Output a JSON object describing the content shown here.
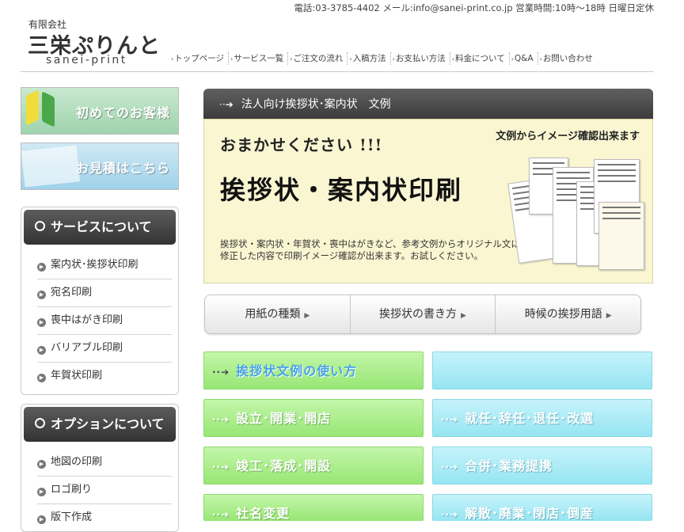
{
  "header": {
    "contact": "電話:03-3785-4402 メール:info@sanei-print.co.jp 営業時間:10時～18時 日曜日定休",
    "logo_company_type": "有限会社",
    "logo_name": "三栄ぷりんと",
    "logo_romaji": "sanei-print",
    "nav": [
      "トップページ",
      "サービス一覧",
      "ご注文の流れ",
      "入稿方法",
      "お支払い方法",
      "料金について",
      "Q&A",
      "お問い合わせ"
    ]
  },
  "sidebar": {
    "banner_first": "初めてのお客様",
    "banner_estimate": "お見積はこちら",
    "service_title": "サービスについて",
    "service_items": [
      "案内状･挨拶状印刷",
      "宛名印刷",
      "喪中はがき印刷",
      "バリアブル印刷",
      "年賀状印刷"
    ],
    "option_title": "オプションについて",
    "option_items": [
      "地図の印刷",
      "ロゴ刷り",
      "版下作成"
    ]
  },
  "main": {
    "title": "法人向け挨拶状･案内状　文例",
    "hero": {
      "tagline": "おまかせください !!!",
      "check_note": "文例からイメージ確認出来ます",
      "title": "挨拶状・案内状印刷",
      "description": "挨拶状・案内状・年賀状・喪中はがきなど、参考文例からオリジナル文に修正した内容で印刷イメージ確認が出来ます。お試しください。"
    },
    "tabs": [
      "用紙の種類",
      "挨拶状の書き方",
      "時候の挨拶用語"
    ],
    "categories": {
      "usage": "挨拶状文例の使い方",
      "c1": "設立･開業･開店",
      "c2": "就任･辞任･退任･改選",
      "c3": "竣工･落成･開設",
      "c4": "合併･業務提携",
      "c5": "社名変更",
      "c6": "解散･廃業･閉店･倒産"
    }
  },
  "colors": {
    "green_button": "#a6ec84",
    "blue_button": "#a6eaf6",
    "dark_header": "#454545",
    "hero_bg": "#fbf6d2"
  }
}
